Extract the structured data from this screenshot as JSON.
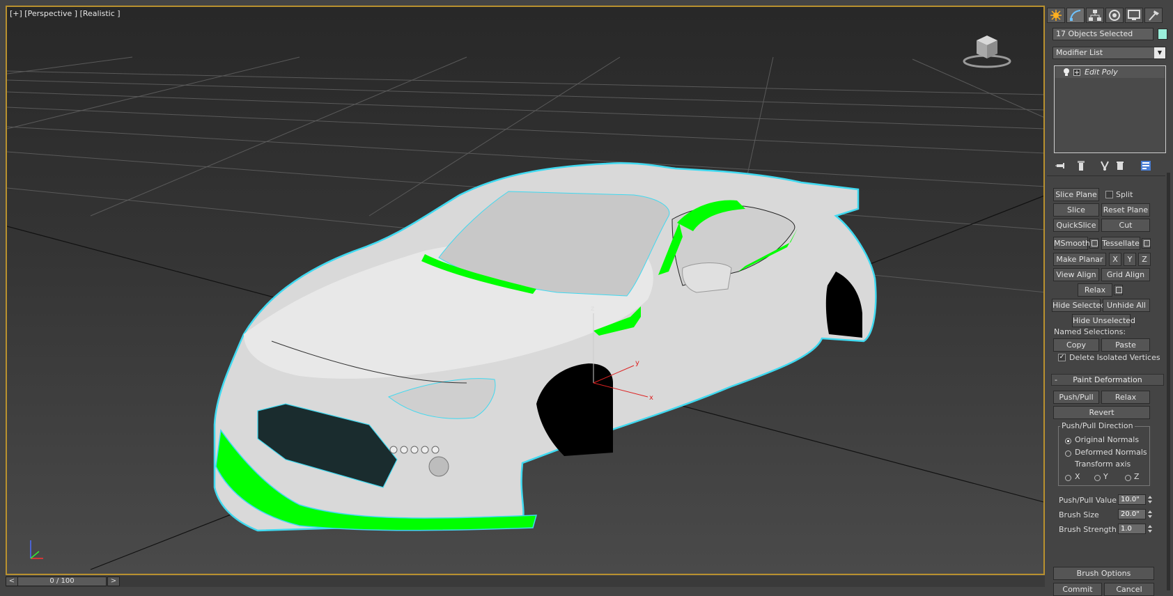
{
  "viewport": {
    "label": "[+] [Perspective ] [Realistic ]",
    "colors": {
      "selection_outline": "#3fd9f0",
      "selected_faces": "#00ff00",
      "frame": "#b9912f"
    }
  },
  "timeline": {
    "frame_display": "0 / 100",
    "prev": "<",
    "next": ">"
  },
  "panel": {
    "tabs": [
      "create-icon",
      "modify-icon",
      "hierarchy-icon",
      "motion-icon",
      "display-icon",
      "utilities-icon"
    ],
    "selection_name": "17 Objects Selected",
    "modifier_list": "Modifier List",
    "stack_item": "Edit Poly",
    "edit_geometry": {
      "slice_plane": "Slice Plane",
      "split": "Split",
      "slice": "Slice",
      "reset_plane": "Reset Plane",
      "quickslice": "QuickSlice",
      "cut": "Cut",
      "msmooth": "MSmooth",
      "tessellate": "Tessellate",
      "make_planar": "Make Planar",
      "x": "X",
      "y": "Y",
      "z": "Z",
      "view_align": "View Align",
      "grid_align": "Grid Align",
      "relax": "Relax",
      "hide_selected": "Hide Selected",
      "unhide_all": "Unhide All",
      "hide_unselected": "Hide Unselected",
      "named_selections": "Named Selections:",
      "copy": "Copy",
      "paste": "Paste",
      "delete_isolated": "Delete Isolated Vertices"
    },
    "paint_deformation": {
      "title": "Paint Deformation",
      "collapse_sign": "-",
      "push_pull": "Push/Pull",
      "relax": "Relax",
      "revert": "Revert",
      "direction_group": "Push/Pull Direction",
      "original_normals": "Original Normals",
      "deformed_normals": "Deformed Normals",
      "transform_axis": "Transform axis",
      "axis_x": "X",
      "axis_y": "Y",
      "axis_z": "Z",
      "push_pull_value_label": "Push/Pull Value",
      "push_pull_value": "10.0\"",
      "brush_size_label": "Brush Size",
      "brush_size": "20.0\"",
      "brush_strength_label": "Brush Strength",
      "brush_strength": "1.0",
      "brush_options": "Brush Options",
      "commit": "Commit",
      "cancel": "Cancel"
    }
  }
}
